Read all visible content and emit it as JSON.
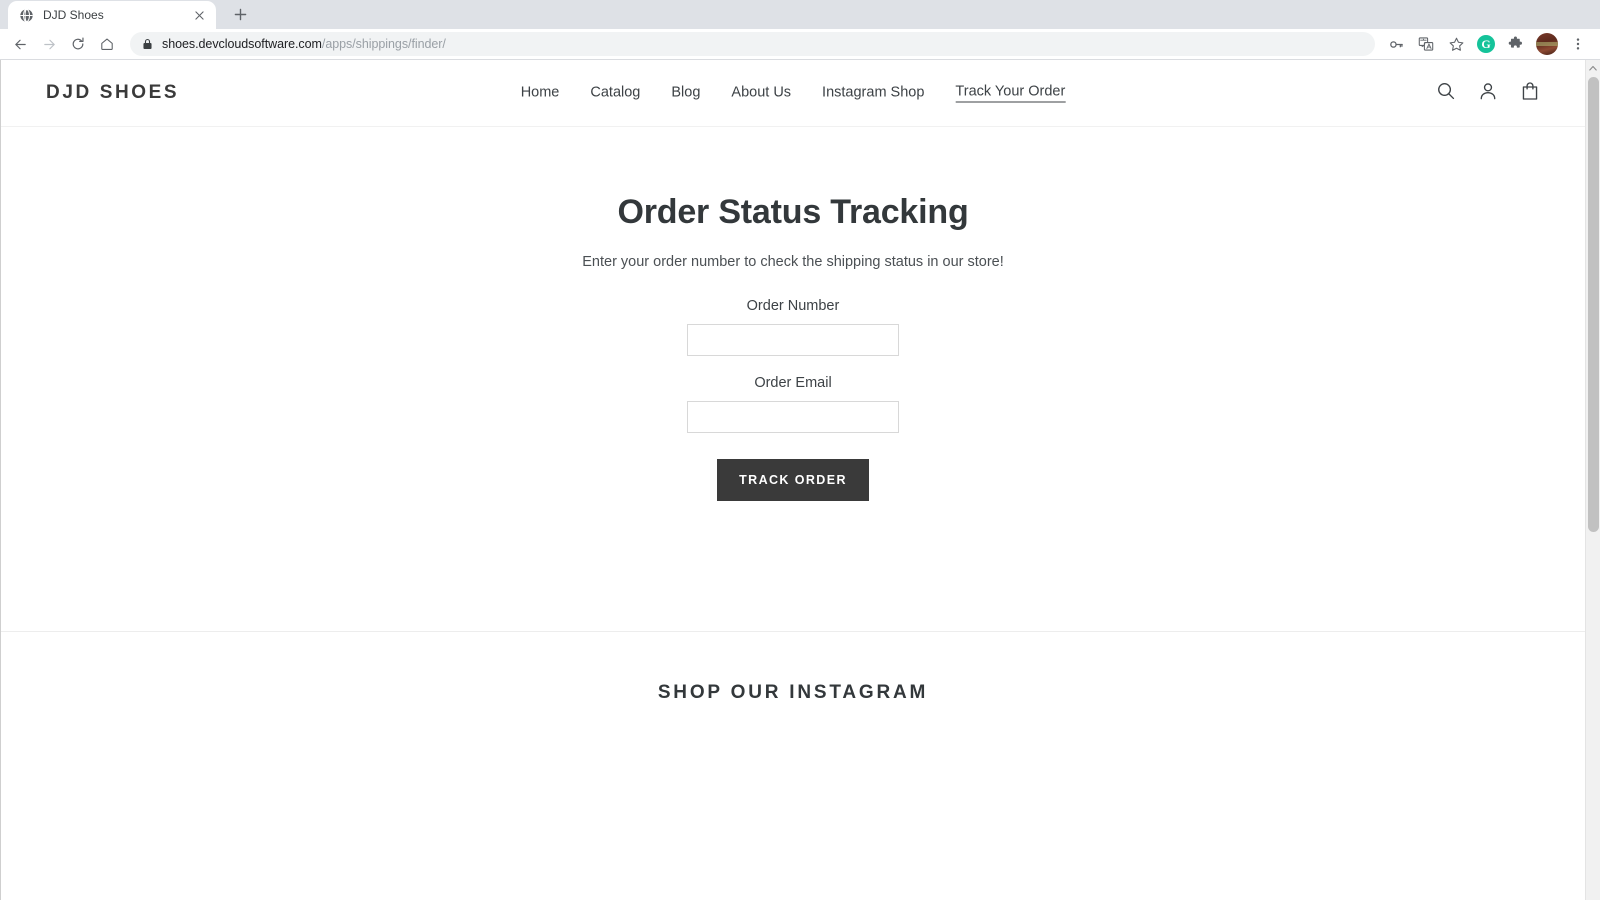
{
  "browser": {
    "tab": {
      "title": "DJD Shoes",
      "favicon_icon": "globe-icon",
      "close_icon": "close-icon"
    },
    "new_tab_icon": "plus-icon",
    "nav": {
      "back_icon": "arrow-back-icon",
      "forward_icon": "arrow-forward-icon",
      "reload_icon": "reload-icon",
      "home_icon": "home-icon"
    },
    "omnibox": {
      "lock_icon": "lock-icon",
      "url_host": "shoes.devcloudsoftware.com",
      "url_path": "/apps/shippings/finder/",
      "full_url": "shoes.devcloudsoftware.com/apps/shippings/finder/"
    },
    "toolbar_right": {
      "password_icon": "key-icon",
      "translate_icon": "translate-icon",
      "bookmark_icon": "star-icon",
      "grammarly_icon": "grammarly-icon",
      "grammarly_letter": "G",
      "extensions_icon": "puzzle-icon",
      "profile_icon": "profile-avatar-icon",
      "menu_icon": "three-dot-menu-icon"
    },
    "scrollbar": {
      "up_arrow_icon": "scroll-up-arrow-icon"
    }
  },
  "site": {
    "logo": "DJD SHOES",
    "nav_items": [
      {
        "label": "Home",
        "active": false
      },
      {
        "label": "Catalog",
        "active": false
      },
      {
        "label": "Blog",
        "active": false
      },
      {
        "label": "About Us",
        "active": false
      },
      {
        "label": "Instagram Shop",
        "active": false
      },
      {
        "label": "Track Your Order",
        "active": true
      }
    ],
    "header_icons": {
      "search_icon": "search-icon",
      "account_icon": "user-account-icon",
      "cart_icon": "shopping-bag-icon"
    }
  },
  "main": {
    "title": "Order Status Tracking",
    "subtitle": "Enter your order number to check the shipping status in our store!",
    "fields": [
      {
        "label": "Order Number",
        "value": "",
        "placeholder": ""
      },
      {
        "label": "Order Email",
        "value": "",
        "placeholder": ""
      }
    ],
    "submit_label": "TRACK ORDER"
  },
  "instagram": {
    "title": "SHOP OUR INSTAGRAM"
  },
  "colors": {
    "button_bg": "#3a3a3a",
    "text_dark": "#33383b",
    "border_light": "#d8d8d8",
    "grammarly_green": "#15c39a"
  }
}
